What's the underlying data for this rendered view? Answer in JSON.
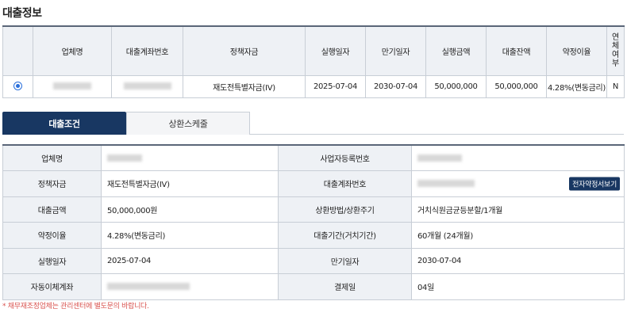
{
  "section_title": "대출정보",
  "loan_table": {
    "headers": [
      "",
      "업체명",
      "대출계좌번호",
      "정책자금",
      "실행일자",
      "만기일자",
      "실행금액",
      "대출잔액",
      "약정이율",
      "연체여부"
    ],
    "row": {
      "policy_fund": "재도전특별자금(IV)",
      "exec_date": "2025-07-04",
      "maturity_date": "2030-07-04",
      "exec_amount": "50,000,000",
      "balance": "50,000,000",
      "rate": "4.28%(변동금리)",
      "overdue": "N"
    }
  },
  "tabs": {
    "active": "대출조건",
    "inactive": "상환스케줄"
  },
  "detail": {
    "company_label": "업체명",
    "biz_no_label": "사업자등록번호",
    "policy_fund_label": "정책자금",
    "policy_fund_value": "재도전특별자금(IV)",
    "account_label": "대출계좌번호",
    "contract_button": "전자약정서보기",
    "amount_label": "대출금액",
    "amount_value": "50,000,000원",
    "repay_label": "상환방법/상환주기",
    "repay_value": "거치식원금균등분할/1개월",
    "rate_label": "약정이율",
    "rate_value": "4.28%(변동금리)",
    "period_label": "대출기간(거치기간)",
    "period_value": "60개월 (24개월)",
    "exec_date_label": "실행일자",
    "exec_date_value": "2025-07-04",
    "maturity_label": "만기일자",
    "maturity_value": "2030-07-04",
    "auto_account_label": "자동이체계좌",
    "pay_day_label": "결제일",
    "pay_day_value": "04일"
  },
  "notice": "* 채무재조정업체는 관리센터에 별도문의 바랍니다.",
  "colors": {
    "navy": "#183762",
    "header_bg": "#eef1f5",
    "border": "#c8ced6",
    "notice_red": "#d9534f",
    "radio_blue": "#2a6fdb"
  }
}
